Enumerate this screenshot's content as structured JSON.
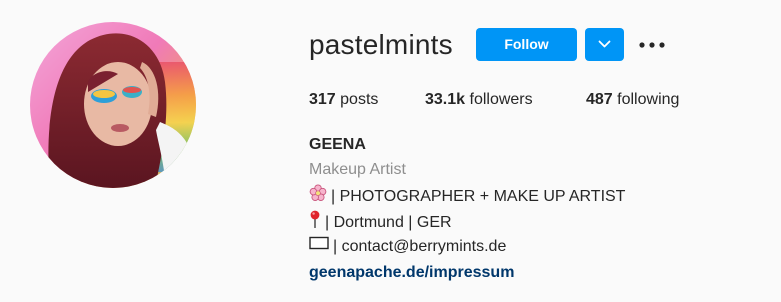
{
  "profile": {
    "username": "pastelmints",
    "follow_label": "Follow",
    "stats": {
      "posts": {
        "count": "317",
        "label": "posts"
      },
      "followers": {
        "count": "33.1k",
        "label": "followers"
      },
      "following": {
        "count": "487",
        "label": "following"
      }
    },
    "full_name": "GEENA",
    "category": "Makeup Artist",
    "bio": [
      {
        "icon": "cherry-blossom-icon",
        "text": "| PHOTOGRAPHER + MAKE UP ARTIST"
      },
      {
        "icon": "round-pushpin-icon",
        "text": "| Dortmund | GER"
      },
      {
        "icon": "envelope-icon",
        "text": "| contact@berrymints.de"
      }
    ],
    "website": "geenapache.de/impressum"
  },
  "colors": {
    "button_blue": "#0095f6",
    "text_primary": "#262626",
    "text_secondary": "#8e8e8e",
    "link": "#00376b",
    "background": "#fafafa"
  }
}
